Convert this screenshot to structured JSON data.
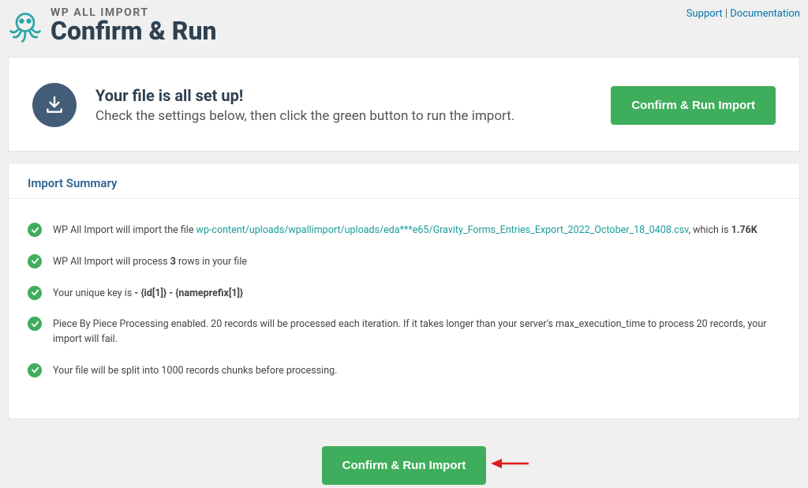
{
  "brand": {
    "tagline": "WP ALL IMPORT",
    "title": "Confirm & Run"
  },
  "top_links": {
    "support": "Support",
    "separator": " | ",
    "documentation": "Documentation"
  },
  "setup": {
    "heading": "Your file is all set up!",
    "subheading": "Check the settings below, then click the green button to run the import.",
    "button": "Confirm & Run Import"
  },
  "summary": {
    "title": "Import Summary",
    "items": {
      "file": {
        "prefix": "WP All Import will import the file ",
        "path": "wp-content/uploads/wpallimport/uploads/eda***e65/Gravity_Forms_Entries_Export_2022_October_18_0408.csv",
        "mid": ", which is ",
        "size": "1.76K"
      },
      "rows": {
        "prefix": "WP All Import will process ",
        "count": "3",
        "suffix": " rows in your file"
      },
      "unique": {
        "prefix": "Your unique key is ",
        "key": "- {id[1]} - {nameprefix[1]}"
      },
      "piece": "Piece By Piece Processing enabled. 20 records will be processed each iteration. If it takes longer than your server's max_execution_time to process 20 records, your import will fail.",
      "chunks": "Your file will be split into 1000 records chunks before processing."
    }
  },
  "bottom": {
    "button": "Confirm & Run Import"
  }
}
